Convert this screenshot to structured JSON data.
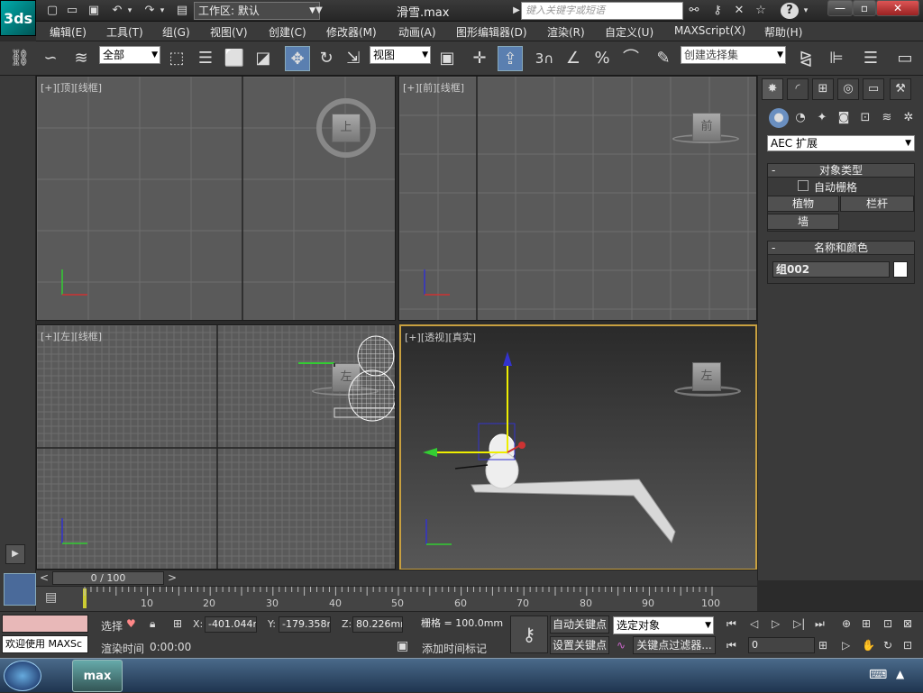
{
  "titlebar": {
    "logo_text": "3ds",
    "workspace": "工作区: 默认",
    "title": "滑雪.max",
    "search_placeholder": "键入关键字或短语",
    "help_label": "?"
  },
  "menubar": {
    "items": [
      "编辑(E)",
      "工具(T)",
      "组(G)",
      "视图(V)",
      "创建(C)",
      "修改器(M)",
      "动画(A)",
      "图形编辑器(D)",
      "渲染(R)",
      "自定义(U)",
      "MAXScript(X)",
      "帮助(H)"
    ]
  },
  "toolbar": {
    "selection_filter": "全部",
    "ref_coord": "视图",
    "snap_number": "3",
    "selection_set_placeholder": "创建选择集"
  },
  "viewports": {
    "top": {
      "plus": "[+]",
      "name": "[顶]",
      "mode": "[线框]",
      "cube_label": "上"
    },
    "front": {
      "plus": "[+]",
      "name": "[前]",
      "mode": "[线框]",
      "cube_label": "前"
    },
    "left": {
      "plus": "[+]",
      "name": "[左]",
      "mode": "[线框]",
      "cube_label": "左"
    },
    "perspective": {
      "plus": "[+]",
      "name": "[透视]",
      "mode": "[真实]",
      "cube_label": "左"
    }
  },
  "command_panel": {
    "category": "AEC 扩展",
    "object_type_title": "对象类型",
    "auto_grid_label": "自动栅格",
    "auto_grid_checked": false,
    "buttons": [
      "植物",
      "栏杆",
      "墙"
    ],
    "name_color_title": "名称和颜色",
    "object_name": "组002",
    "object_color": "#ffffff"
  },
  "timeline": {
    "frame_label": "0 / 100",
    "ticks": [
      "10",
      "20",
      "30",
      "40",
      "50",
      "60",
      "70",
      "80",
      "90",
      "100"
    ]
  },
  "statusbar": {
    "prompt": "欢迎使用 MAXSc",
    "selection_label": "选择",
    "x_label": "X:",
    "x_value": "-401.044m",
    "y_label": "Y:",
    "y_value": "-179.358m",
    "z_label": "Z:",
    "z_value": "80.226mm",
    "grid_label": "栅格 = 100.0mm",
    "render_time_label": "渲染时间",
    "render_time_value": "0:00:00",
    "add_time_tag": "添加时间标记",
    "auto_key": "自动关键点",
    "set_key": "设置关键点",
    "key_mode": "选定对象",
    "key_filters": "关键点过滤器...",
    "current_frame": "0"
  },
  "taskbar": {
    "app_label": "max"
  }
}
